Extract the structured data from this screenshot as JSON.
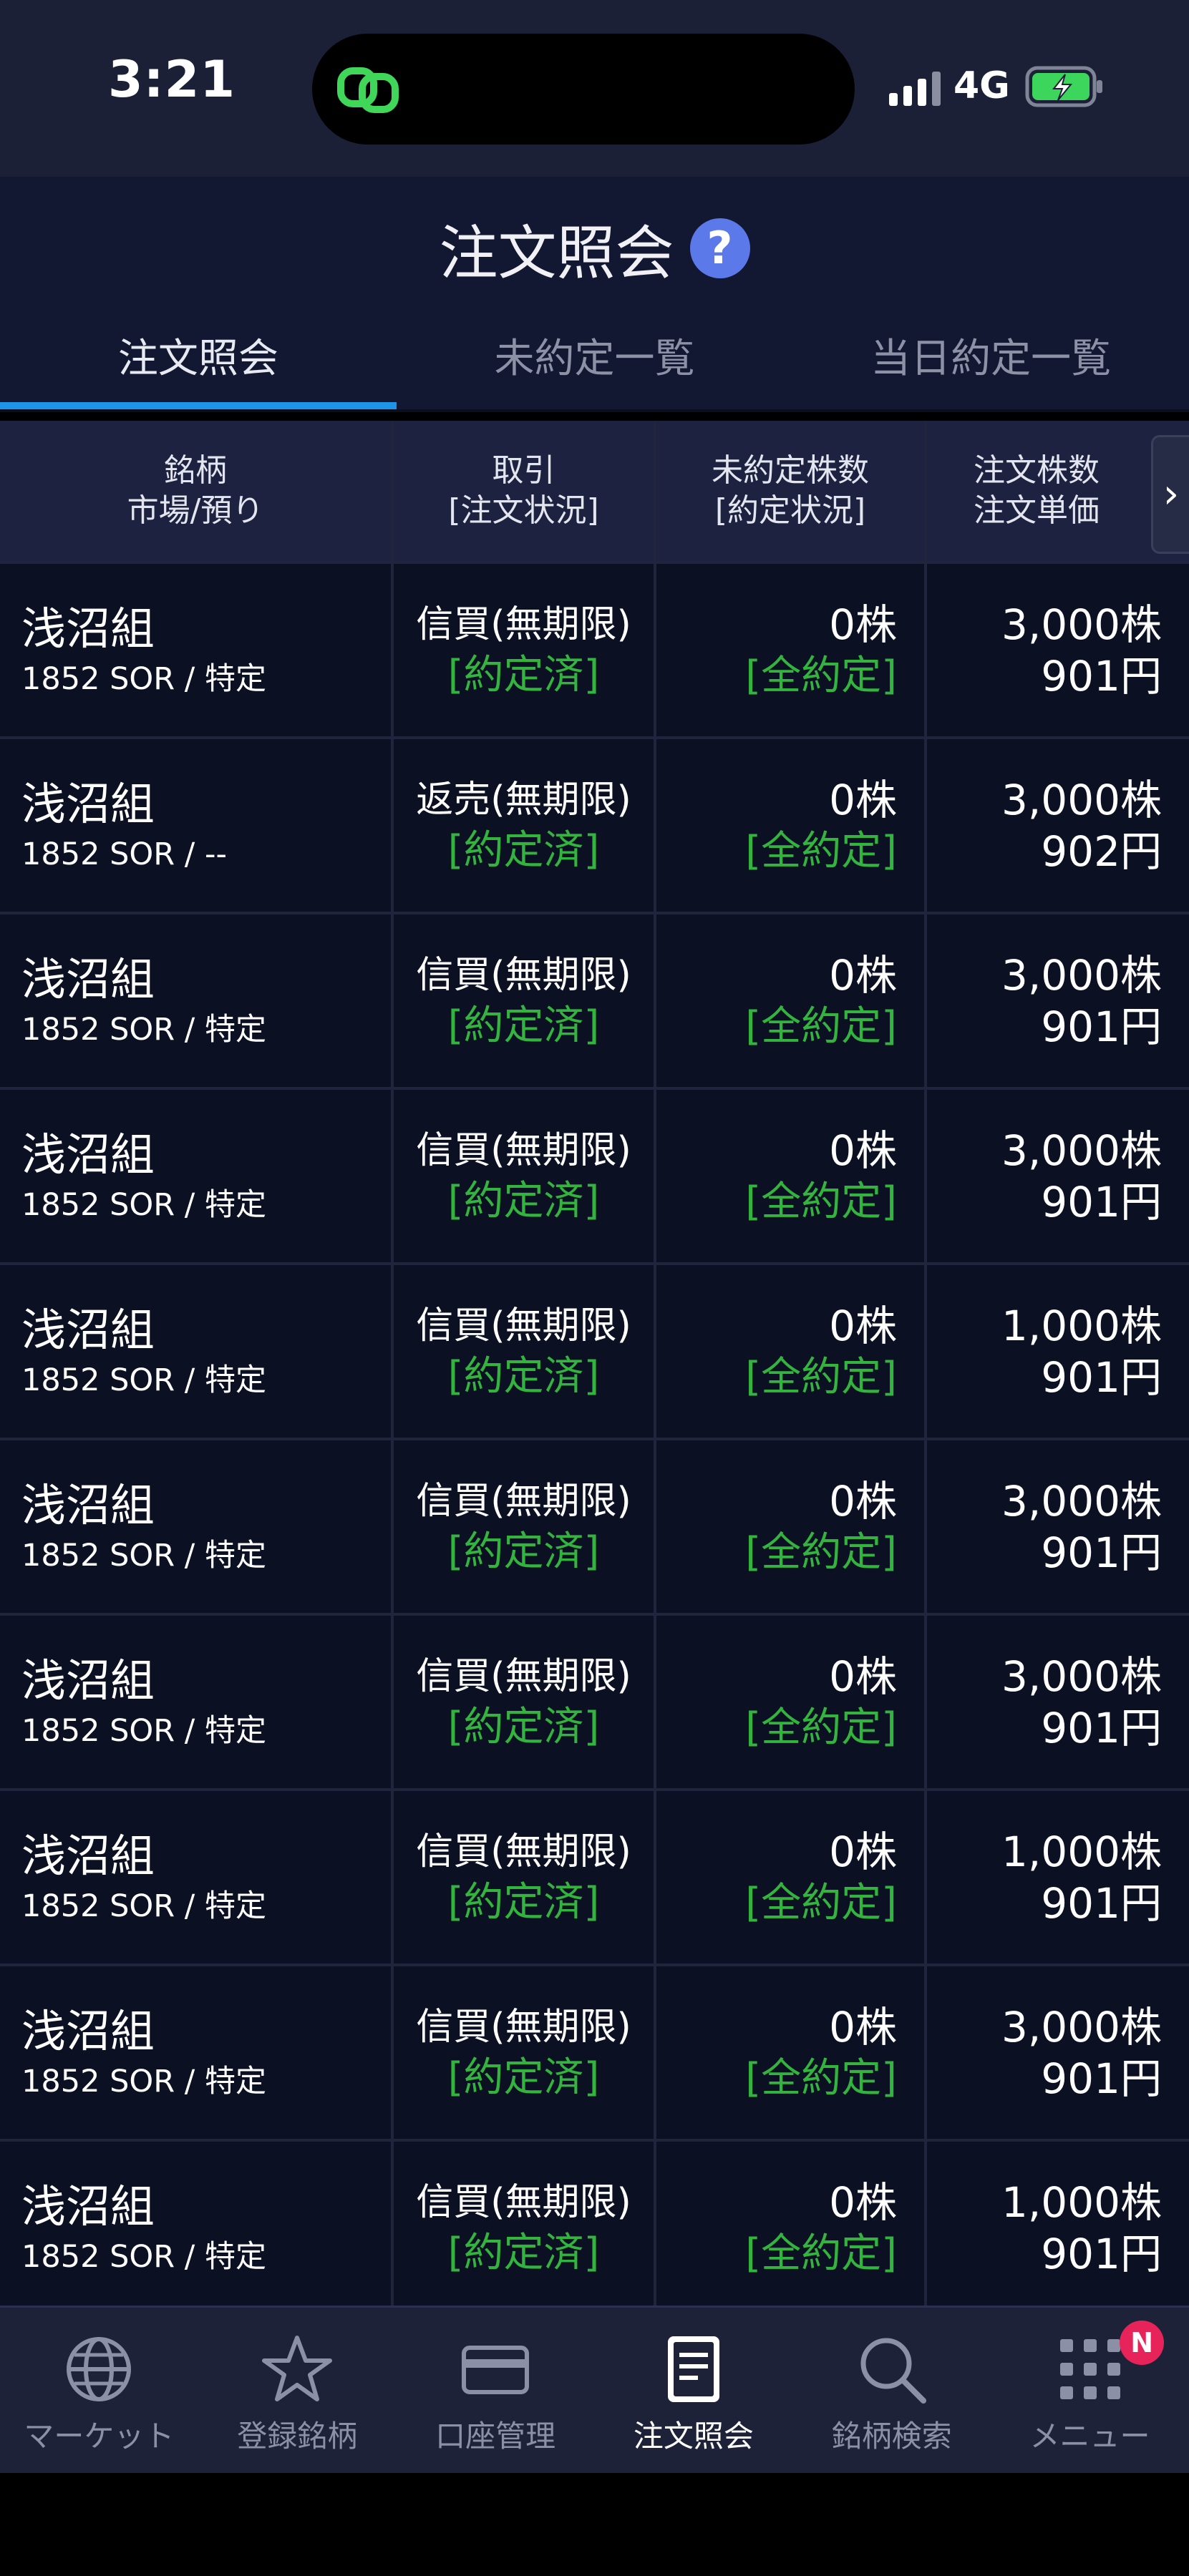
{
  "status_bar": {
    "time": "3:21",
    "network": "4G"
  },
  "header": {
    "title": "注文照会",
    "help_symbol": "?"
  },
  "tabs": [
    {
      "label": "注文照会",
      "active": true
    },
    {
      "label": "未約定一覧",
      "active": false
    },
    {
      "label": "当日約定一覧",
      "active": false
    }
  ],
  "table": {
    "headers": [
      {
        "line1": "銘柄",
        "line2": "市場/預り"
      },
      {
        "line1": "取引",
        "line2": "[注文状況]"
      },
      {
        "line1": "未約定株数",
        "line2": "[約定状況]"
      },
      {
        "line1": "注文株数",
        "line2": "注文単価"
      }
    ],
    "scroll_symbol": "›",
    "rows": [
      {
        "name": "浅沼組",
        "sub": "1852 SOR / 特定",
        "trade": "信買(無期限)",
        "status": "[約定済]",
        "unfilled": "0株",
        "fill_status": "[全約定]",
        "qty": "3,000株",
        "price": "901円"
      },
      {
        "name": "浅沼組",
        "sub": "1852 SOR / --",
        "trade": "返売(無期限)",
        "status": "[約定済]",
        "unfilled": "0株",
        "fill_status": "[全約定]",
        "qty": "3,000株",
        "price": "902円"
      },
      {
        "name": "浅沼組",
        "sub": "1852 SOR / 特定",
        "trade": "信買(無期限)",
        "status": "[約定済]",
        "unfilled": "0株",
        "fill_status": "[全約定]",
        "qty": "3,000株",
        "price": "901円"
      },
      {
        "name": "浅沼組",
        "sub": "1852 SOR / 特定",
        "trade": "信買(無期限)",
        "status": "[約定済]",
        "unfilled": "0株",
        "fill_status": "[全約定]",
        "qty": "3,000株",
        "price": "901円"
      },
      {
        "name": "浅沼組",
        "sub": "1852 SOR / 特定",
        "trade": "信買(無期限)",
        "status": "[約定済]",
        "unfilled": "0株",
        "fill_status": "[全約定]",
        "qty": "1,000株",
        "price": "901円"
      },
      {
        "name": "浅沼組",
        "sub": "1852 SOR / 特定",
        "trade": "信買(無期限)",
        "status": "[約定済]",
        "unfilled": "0株",
        "fill_status": "[全約定]",
        "qty": "3,000株",
        "price": "901円"
      },
      {
        "name": "浅沼組",
        "sub": "1852 SOR / 特定",
        "trade": "信買(無期限)",
        "status": "[約定済]",
        "unfilled": "0株",
        "fill_status": "[全約定]",
        "qty": "3,000株",
        "price": "901円"
      },
      {
        "name": "浅沼組",
        "sub": "1852 SOR / 特定",
        "trade": "信買(無期限)",
        "status": "[約定済]",
        "unfilled": "0株",
        "fill_status": "[全約定]",
        "qty": "1,000株",
        "price": "901円"
      },
      {
        "name": "浅沼組",
        "sub": "1852 SOR / 特定",
        "trade": "信買(無期限)",
        "status": "[約定済]",
        "unfilled": "0株",
        "fill_status": "[全約定]",
        "qty": "3,000株",
        "price": "901円"
      },
      {
        "name": "浅沼組",
        "sub": "1852 SOR / 特定",
        "trade": "信買(無期限)",
        "status": "[約定済]",
        "unfilled": "0株",
        "fill_status": "[全約定]",
        "qty": "1,000株",
        "price": "901円"
      }
    ]
  },
  "bottom_nav": [
    {
      "label": "マーケット",
      "icon": "globe-icon",
      "active": false
    },
    {
      "label": "登録銘柄",
      "icon": "star-icon",
      "active": false
    },
    {
      "label": "口座管理",
      "icon": "credit-card-icon",
      "active": false
    },
    {
      "label": "注文照会",
      "icon": "document-icon",
      "active": true
    },
    {
      "label": "銘柄検索",
      "icon": "search-icon",
      "active": false
    },
    {
      "label": "メニュー",
      "icon": "grid-menu-icon",
      "active": false
    }
  ],
  "menu_badge": "N",
  "colors": {
    "accent_tab": "#1e94e8",
    "filled_status": "#33b43e",
    "badge": "#e6245a",
    "help_icon": "#5b79e8"
  }
}
